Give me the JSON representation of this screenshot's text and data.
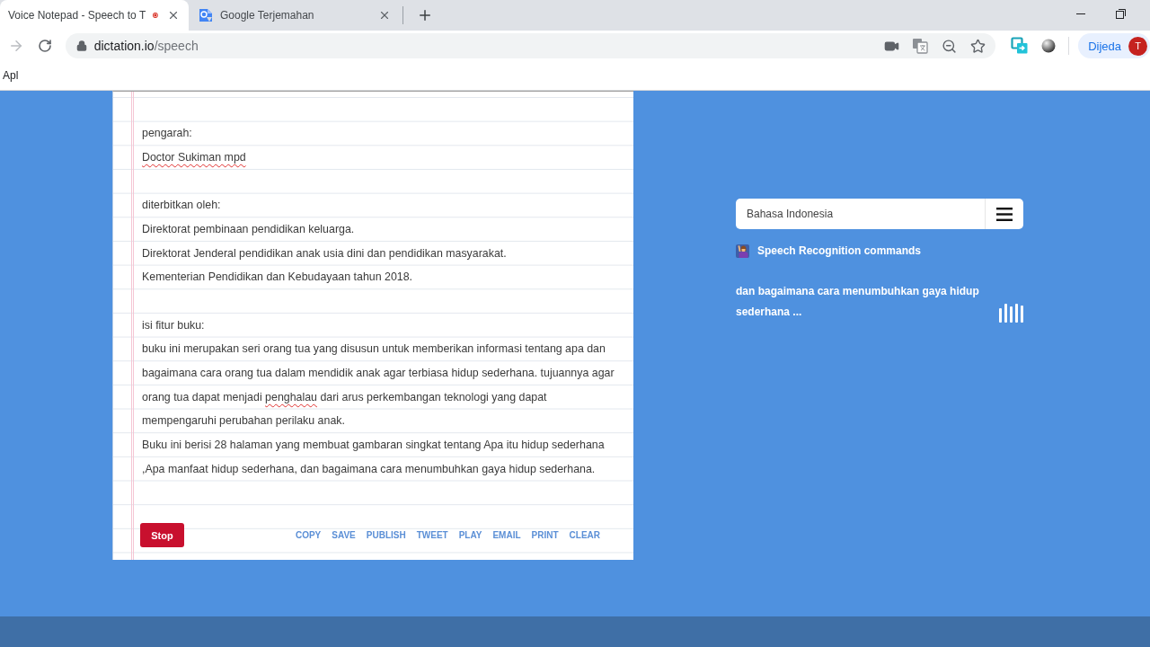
{
  "browser": {
    "tabs": [
      {
        "title": "Voice Notepad - Speech to T",
        "selected": true,
        "favicon": false,
        "recording": true
      },
      {
        "title": "Google Terjemahan",
        "selected": false,
        "favicon": true,
        "recording": false
      }
    ],
    "navigation": {
      "forward_disabled": true
    },
    "address": {
      "host": "dictation.io",
      "path": "/speech"
    },
    "profile": {
      "label": "Dijeda",
      "initial": "T"
    },
    "bookmarks": [
      "Apl"
    ]
  },
  "notepad": {
    "lines": [
      {
        "kind": "blank"
      },
      {
        "kind": "text",
        "parts": [
          {
            "text": "pengarah:",
            "misspelled": false
          }
        ]
      },
      {
        "kind": "text",
        "parts": [
          {
            "text": "Doctor Sukiman mpd",
            "misspelled": true
          }
        ]
      },
      {
        "kind": "blank"
      },
      {
        "kind": "text",
        "parts": [
          {
            "text": "diterbitkan oleh:",
            "misspelled": false
          }
        ]
      },
      {
        "kind": "text",
        "parts": [
          {
            "text": "Direktorat pembinaan pendidikan keluarga.",
            "misspelled": false
          }
        ]
      },
      {
        "kind": "text",
        "parts": [
          {
            "text": "Direktorat Jenderal pendidikan anak usia dini dan pendidikan masyarakat.",
            "misspelled": false
          }
        ]
      },
      {
        "kind": "text",
        "parts": [
          {
            "text": "Kementerian Pendidikan dan Kebudayaan tahun 2018.",
            "misspelled": false
          }
        ]
      },
      {
        "kind": "blank"
      },
      {
        "kind": "text",
        "parts": [
          {
            "text": "isi fitur buku:",
            "misspelled": false
          }
        ]
      },
      {
        "kind": "text",
        "parts": [
          {
            "text": "buku ini merupakan seri orang tua yang disusun untuk memberikan informasi tentang apa dan",
            "misspelled": false
          }
        ]
      },
      {
        "kind": "text",
        "parts": [
          {
            "text": "bagaimana cara orang tua dalam mendidik anak agar terbiasa hidup sederhana. tujuannya agar",
            "misspelled": false
          }
        ]
      },
      {
        "kind": "text",
        "parts": [
          {
            "text": "orang tua dapat menjadi ",
            "misspelled": false
          },
          {
            "text": "penghalau",
            "misspelled": true
          },
          {
            "text": " dari arus perkembangan teknologi yang dapat",
            "misspelled": false
          }
        ]
      },
      {
        "kind": "text",
        "parts": [
          {
            "text": "mempengaruhi perubahan perilaku anak.",
            "misspelled": false
          }
        ]
      },
      {
        "kind": "text",
        "parts": [
          {
            "text": "Buku ini berisi 28 halaman yang membuat gambaran singkat tentang Apa itu hidup sederhana",
            "misspelled": false
          }
        ]
      },
      {
        "kind": "text",
        "parts": [
          {
            "text": ",Apa manfaat hidup sederhana, dan bagaimana cara menumbuhkan gaya hidup sederhana.",
            "misspelled": false
          }
        ]
      },
      {
        "kind": "blank"
      }
    ],
    "stop_button": "Stop",
    "actions": [
      "COPY",
      "SAVE",
      "PUBLISH",
      "TWEET",
      "PLAY",
      "EMAIL",
      "PRINT",
      "CLEAR"
    ]
  },
  "sidebar": {
    "language": "Bahasa Indonesia",
    "commands_link": "Speech Recognition commands",
    "interim_text": "dan bagaimana cara menumbuhkan gaya hidup sederhana ..."
  }
}
